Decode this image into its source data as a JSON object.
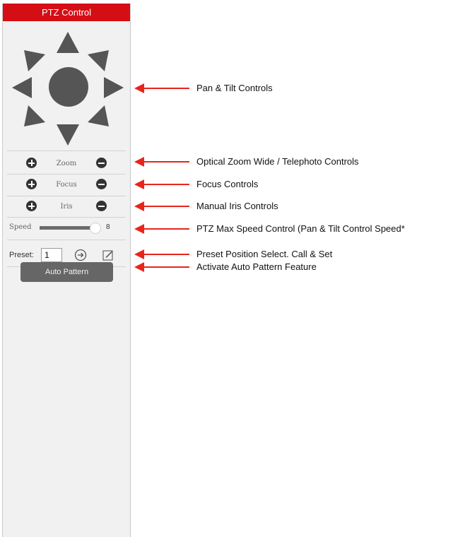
{
  "panel": {
    "title": "PTZ Control",
    "accent_color": "#d50e15",
    "dpad": {
      "icons": [
        "arrow-up-icon",
        "arrow-up-right-icon",
        "arrow-right-icon",
        "arrow-down-right-icon",
        "arrow-down-icon",
        "arrow-down-left-icon",
        "arrow-left-icon",
        "arrow-up-left-icon",
        "center-circle-icon"
      ]
    },
    "zoom": {
      "label": "Zoom",
      "plus_icon": "plus-circle-icon",
      "minus_icon": "minus-circle-icon"
    },
    "focus": {
      "label": "Focus",
      "plus_icon": "plus-circle-icon",
      "minus_icon": "minus-circle-icon"
    },
    "iris": {
      "label": "Iris",
      "plus_icon": "plus-circle-icon",
      "minus_icon": "minus-circle-icon"
    },
    "speed": {
      "label": "Speed",
      "value": "8",
      "max": 8
    },
    "preset": {
      "label": "Preset:",
      "value": "1",
      "call_icon": "arrow-circle-right-icon",
      "set_icon": "edit-pencil-icon"
    },
    "auto_pattern_label": "Auto Pattern"
  },
  "annotations": {
    "arrow_color": "#e8251b",
    "items": [
      "Pan & Tilt Controls",
      "Optical Zoom Wide / Telephoto Controls",
      "Focus Controls",
      "Manual Iris Controls",
      "PTZ Max Speed Control (Pan & Tilt Control Speed*",
      "Preset Position Select. Call & Set",
      "Activate Auto Pattern Feature"
    ]
  }
}
